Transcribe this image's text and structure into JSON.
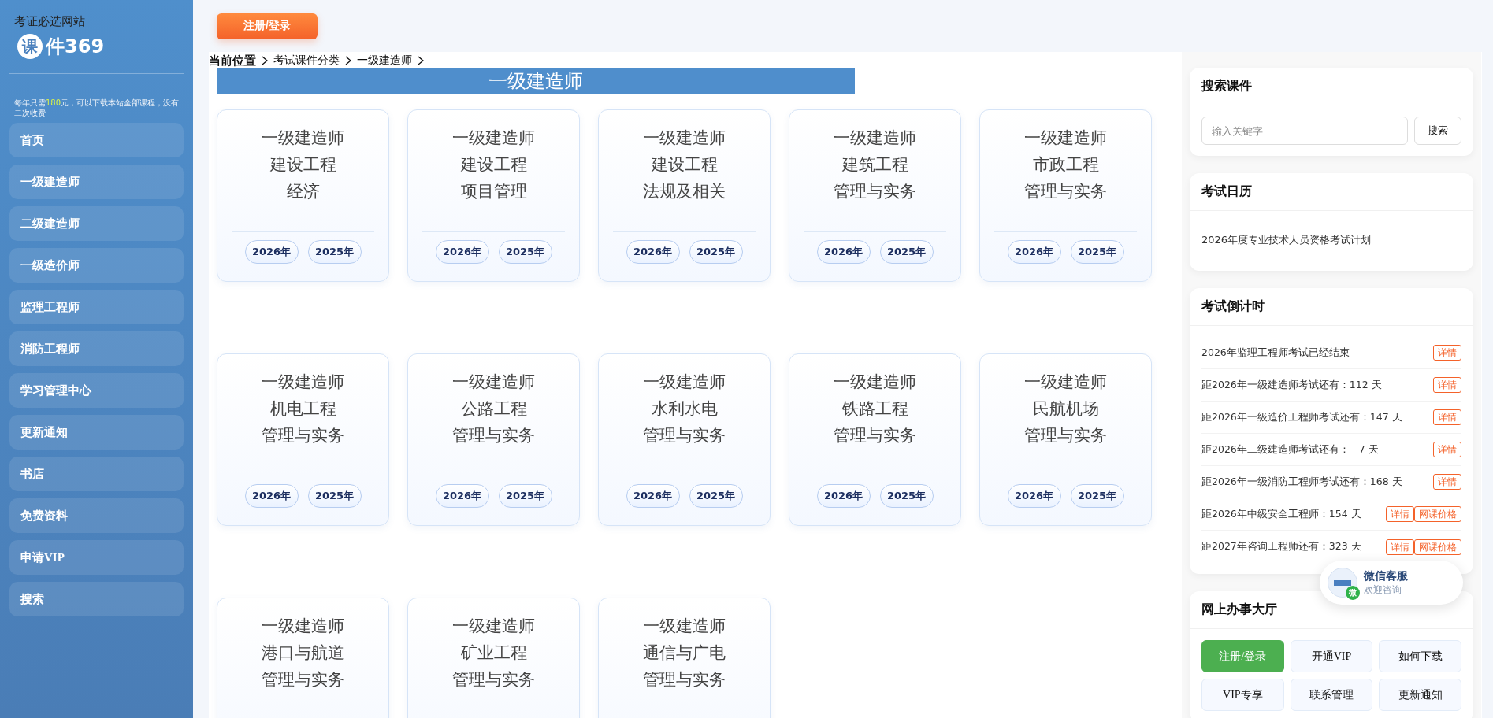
{
  "sidebar": {
    "tagline": "考证必选网站",
    "logo_mark": "课",
    "logo_text": "件369",
    "promo": {
      "before": "每年只需",
      "highlight": "180",
      "after": "元，可以下载本站全部课程，没有二次收费"
    },
    "items": [
      {
        "label": "首页"
      },
      {
        "label": "一级建造师"
      },
      {
        "label": "二级建造师"
      },
      {
        "label": "一级造价师"
      },
      {
        "label": "监理工程师"
      },
      {
        "label": "消防工程师"
      },
      {
        "label": "学习管理中心"
      },
      {
        "label": "更新通知"
      },
      {
        "label": "书店"
      },
      {
        "label": "免费资料"
      },
      {
        "label": "申请VIP"
      },
      {
        "label": "搜索"
      }
    ]
  },
  "top_button": "注册/登录",
  "breadcrumb": {
    "label": "当前位置",
    "items": [
      "考试课件分类",
      "一级建造师"
    ]
  },
  "banner": "一级建造师",
  "courses": [
    {
      "title_lines": [
        "一级建造师",
        "建设工程",
        "经济"
      ],
      "years": [
        "2026年",
        "2025年"
      ]
    },
    {
      "title_lines": [
        "一级建造师",
        "建设工程",
        "项目管理"
      ],
      "years": [
        "2026年",
        "2025年"
      ]
    },
    {
      "title_lines": [
        "一级建造师",
        "建设工程",
        "法规及相关"
      ],
      "years": [
        "2026年",
        "2025年"
      ]
    },
    {
      "title_lines": [
        "一级建造师",
        "建筑工程",
        "管理与实务"
      ],
      "years": [
        "2026年",
        "2025年"
      ]
    },
    {
      "title_lines": [
        "一级建造师",
        "市政工程",
        "管理与实务"
      ],
      "years": [
        "2026年",
        "2025年"
      ]
    },
    {
      "title_lines": [
        "一级建造师",
        "机电工程",
        "管理与实务"
      ],
      "years": [
        "2026年",
        "2025年"
      ]
    },
    {
      "title_lines": [
        "一级建造师",
        "公路工程",
        "管理与实务"
      ],
      "years": [
        "2026年",
        "2025年"
      ]
    },
    {
      "title_lines": [
        "一级建造师",
        "水利水电",
        "管理与实务"
      ],
      "years": [
        "2026年",
        "2025年"
      ]
    },
    {
      "title_lines": [
        "一级建造师",
        "铁路工程",
        "管理与实务"
      ],
      "years": [
        "2026年",
        "2025年"
      ]
    },
    {
      "title_lines": [
        "一级建造师",
        "民航机场",
        "管理与实务"
      ],
      "years": [
        "2026年",
        "2025年"
      ]
    },
    {
      "title_lines": [
        "一级建造师",
        "港口与航道",
        "管理与实务"
      ]
    },
    {
      "title_lines": [
        "一级建造师",
        "矿业工程",
        "管理与实务"
      ]
    },
    {
      "title_lines": [
        "一级建造师",
        "通信与广电",
        "管理与实务"
      ]
    }
  ],
  "search_panel": {
    "title": "搜索课件",
    "placeholder": "输入关键字",
    "button": "搜索"
  },
  "calendar_panel": {
    "title": "考试日历",
    "items": [
      "2026年度专业技术人员资格考试计划"
    ]
  },
  "countdown_panel": {
    "title": "考试倒计时",
    "rows": [
      {
        "text": "2026年监理工程师考试已经结束",
        "links": [
          "详情"
        ]
      },
      {
        "text": "距2026年一级建造师考试还有：112 天",
        "links": [
          "详情"
        ]
      },
      {
        "text": "距2026年一级造价工程师考试还有：147 天",
        "links": [
          "详情"
        ]
      },
      {
        "text": "距2026年二级建造师考试还有：   7 天",
        "links": [
          "详情"
        ]
      },
      {
        "text": "距2026年一级消防工程师考试还有：168 天",
        "links": [
          "详情"
        ]
      },
      {
        "text": "距2026年中级安全工程师：154 天",
        "links": [
          "详情",
          "网课价格"
        ]
      },
      {
        "text": "距2027年咨询工程师还有：323 天",
        "links": [
          "详情",
          "网课价格"
        ]
      }
    ]
  },
  "office_panel": {
    "title": "网上办事大厅",
    "buttons": [
      {
        "label": "注册/登录",
        "kind": "primary"
      },
      {
        "label": "开通VIP",
        "kind": "plain"
      },
      {
        "label": "如何下载",
        "kind": "plain"
      },
      {
        "label": "VIP专享",
        "kind": "plain"
      },
      {
        "label": "联系管理",
        "kind": "plain"
      },
      {
        "label": "更新通知",
        "kind": "plain"
      }
    ]
  },
  "chat_widget": {
    "title": "微信客服",
    "subtitle": "欢迎咨询",
    "badge": "微"
  }
}
